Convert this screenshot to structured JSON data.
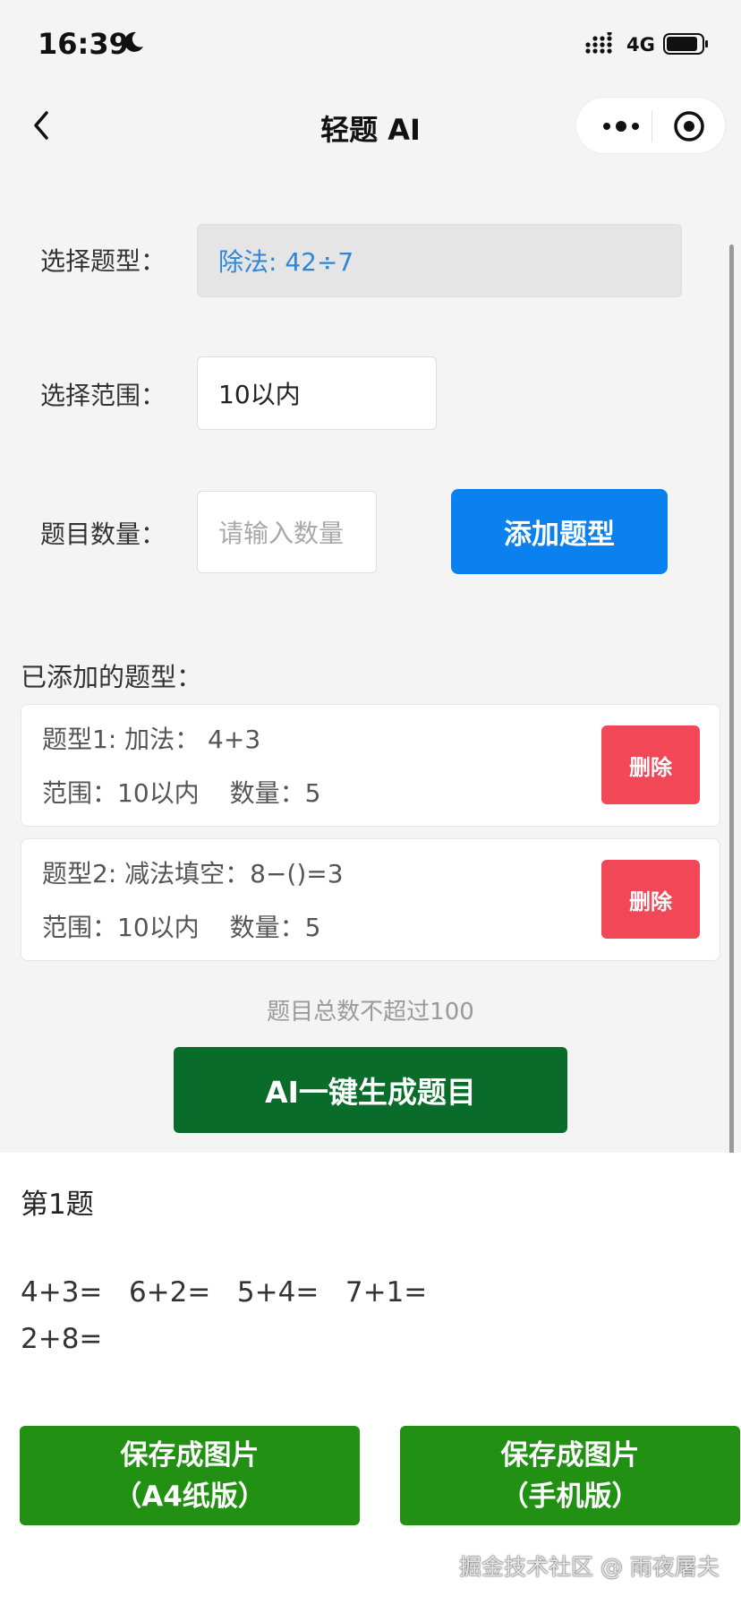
{
  "status_bar": {
    "time": "16:39",
    "network": "4G"
  },
  "nav": {
    "title": "轻题 AI"
  },
  "form": {
    "type_label": "选择题型：",
    "type_value": "除法: 42÷7",
    "range_label": "选择范围：",
    "range_value": "10以内",
    "count_label": "题目数量：",
    "count_placeholder": "请输入数量",
    "add_button": "添加题型"
  },
  "added": {
    "title": "已添加的题型：",
    "items": [
      {
        "name": "题型1: 加法：  4+3",
        "range": "范围：10以内",
        "count": "数量：5",
        "delete_label": "删除"
      },
      {
        "name": "题型2: 减法填空：8−()=3",
        "range": "范围：10以内",
        "count": "数量：5",
        "delete_label": "删除"
      }
    ]
  },
  "hint": "题目总数不超过100",
  "generate_button": "AI一键生成题目",
  "result": {
    "title": "第1题",
    "lines": [
      "4+3=   6+2=   5+4=   7+1=",
      "2+8="
    ],
    "save_a4": {
      "line1": "保存成图片",
      "line2": "（A4纸版）"
    },
    "save_phone": {
      "line1": "保存成图片",
      "line2": "（手机版）"
    }
  },
  "watermark": "掘金技术社区 @ 雨夜屠夫",
  "colors": {
    "primary_blue": "#0b80ef",
    "delete_red": "#f14757",
    "generate_green": "#096c2b",
    "save_green": "#219013"
  },
  "icons": [
    "moon-icon",
    "signal-icon",
    "battery-icon",
    "back-chevron-icon",
    "more-dots-icon",
    "target-icon"
  ]
}
